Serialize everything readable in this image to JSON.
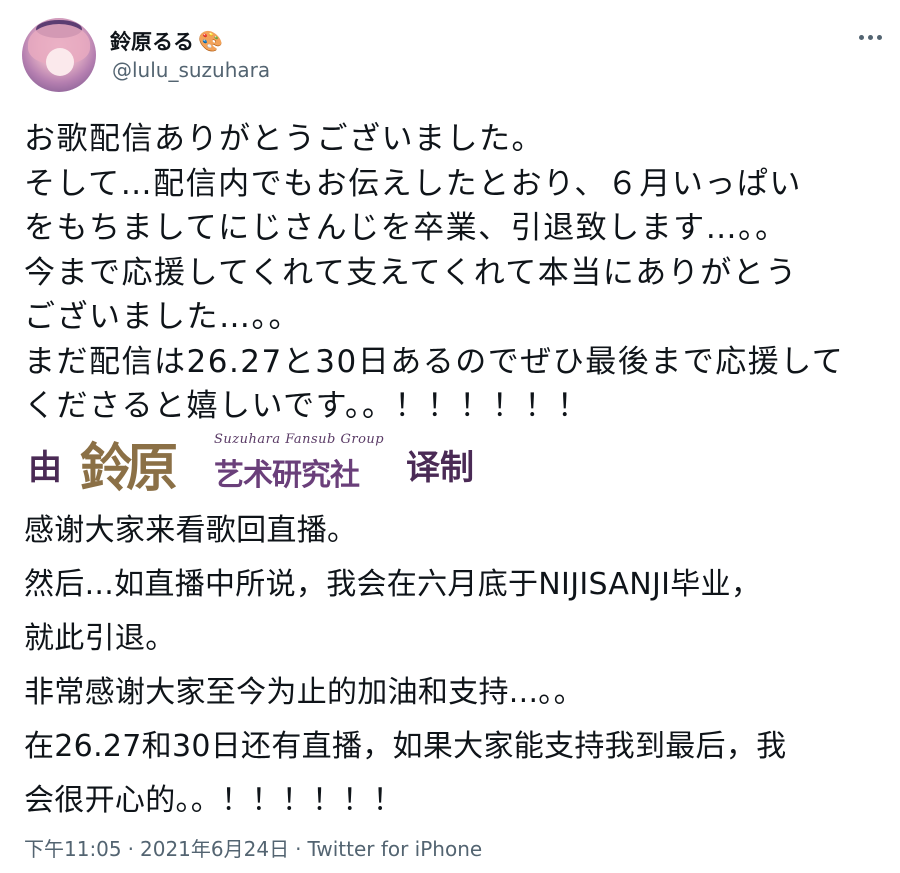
{
  "author": {
    "display_name": "鈴原るる",
    "handle": "@lulu_suzuhara",
    "avatar_icon": "user-avatar",
    "badge_icon": "palette-icon",
    "badge_glyph": "🎨"
  },
  "tweet": {
    "lines": [
      "お歌配信ありがとうございました。",
      "そして…配信内でもお伝えしたとおり、６月いっぱい",
      "をもちましてにじさんじを卒業、引退致します…。。",
      "今まで応援してくれて支えてくれて本当にありがとう",
      "ございました…。。",
      "まだ配信は26.27と30日あるのでぜひ最後まで応援して",
      "くださると嬉しいです。。！！！！！！"
    ]
  },
  "banner": {
    "left_char": "由",
    "name": "鈴原",
    "subtitle": "Suzuhara Fansub Group",
    "club": "艺术研究社",
    "right_text": "译制"
  },
  "translation": {
    "lines": [
      "感谢大家来看歌回直播。",
      "然后...如直播中所说，我会在六月底于NIJISANJI毕业，",
      "就此引退。",
      "非常感谢大家至今为止的加油和支持...。。",
      "在26.27和30日还有直播，如果大家能支持我到最后，我",
      "会很开心的。。！！！！！！"
    ]
  },
  "meta": {
    "time": "下午11:05",
    "separator": "·",
    "date": "2021年6月24日",
    "source": "Twitter for iPhone"
  },
  "colors": {
    "text": "#0f1419",
    "secondary": "#536471",
    "banner_purple": "#4a2a55",
    "banner_gold": "#8b7046"
  }
}
